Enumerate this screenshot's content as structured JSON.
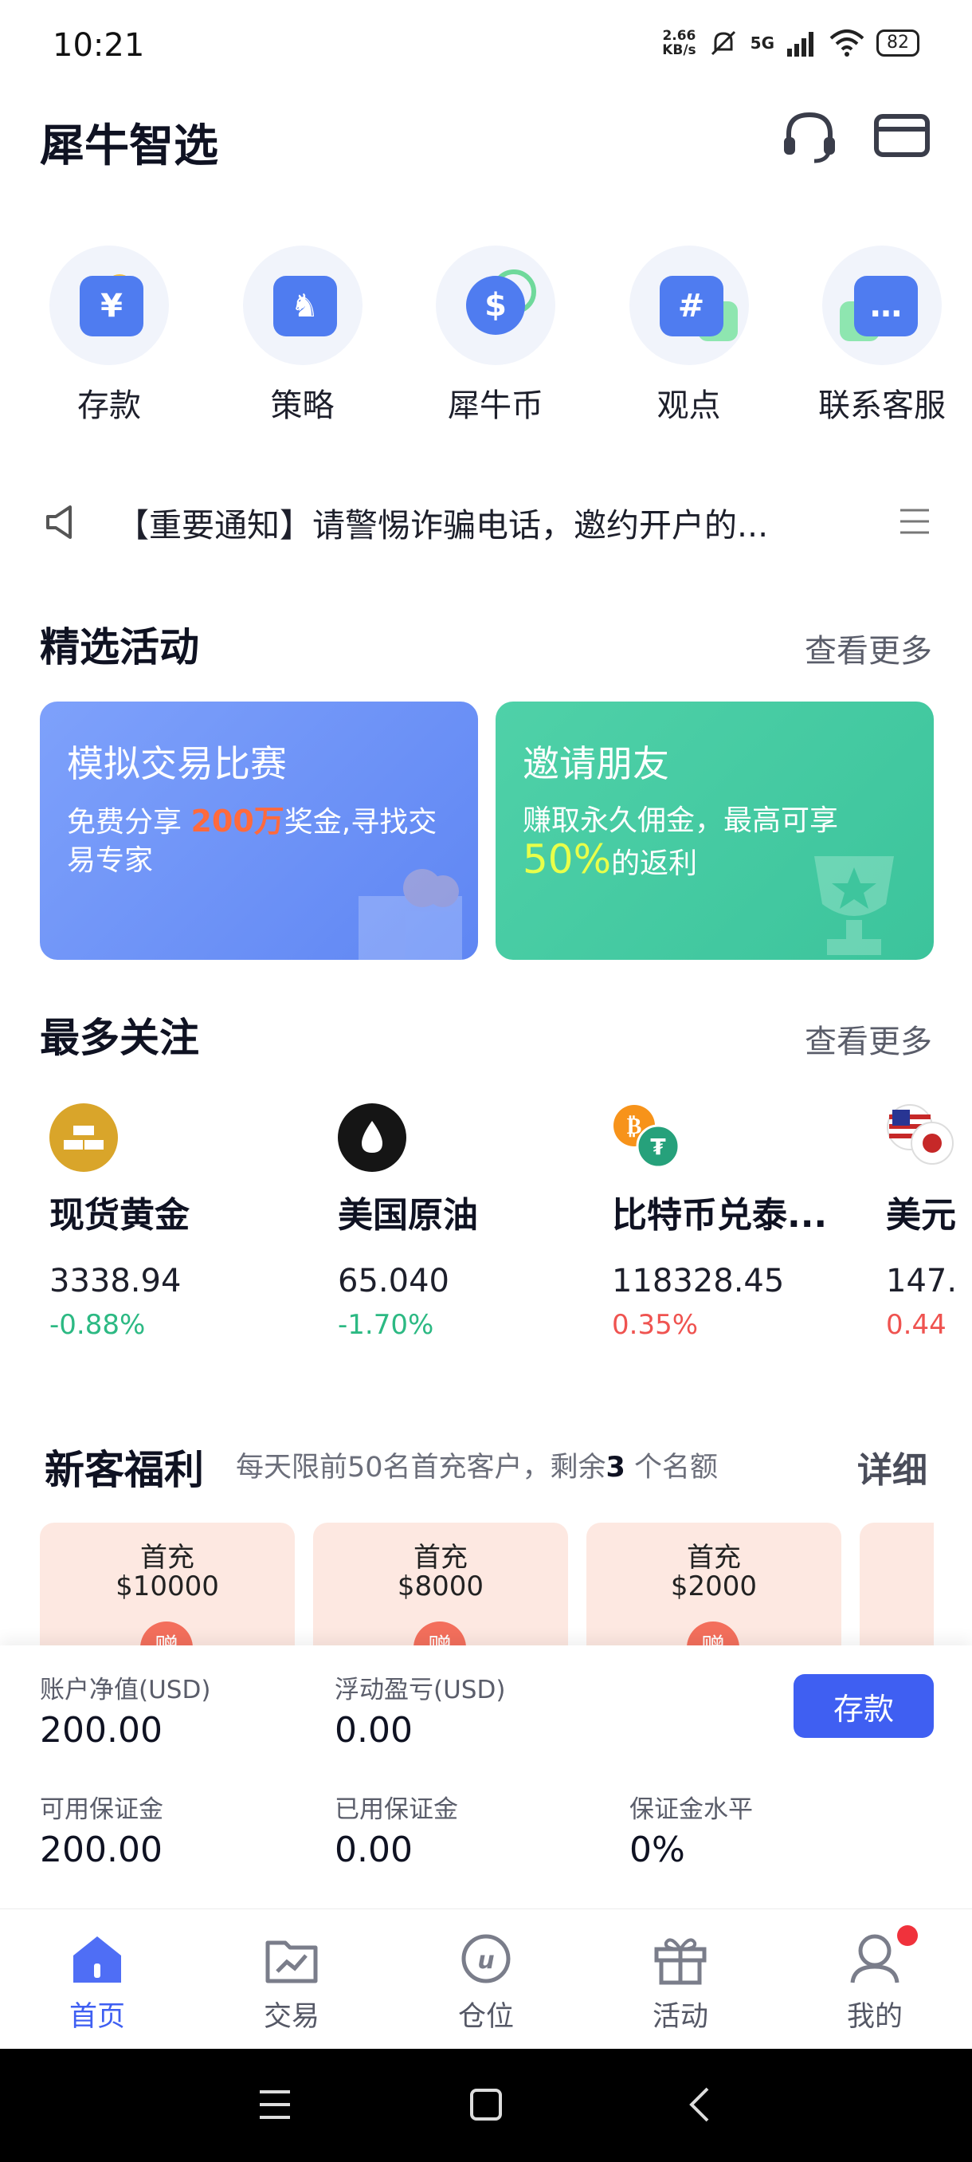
{
  "status": {
    "time": "10:21",
    "net_speed_value": "2.66",
    "net_speed_unit": "KB/s",
    "network": "5G",
    "battery": "82"
  },
  "header": {
    "title": "犀牛智选",
    "icons": [
      "headset-icon",
      "mail-icon"
    ]
  },
  "quick_menu": [
    {
      "label": "存款",
      "icon": "deposit-icon",
      "glyph": "¥"
    },
    {
      "label": "策略",
      "icon": "strategy-icon",
      "glyph": "♞"
    },
    {
      "label": "犀牛币",
      "icon": "coin-icon",
      "glyph": "$"
    },
    {
      "label": "观点",
      "icon": "hashtag-icon",
      "glyph": "#"
    },
    {
      "label": "联系客服",
      "icon": "chat-icon",
      "glyph": "…"
    }
  ],
  "notice": {
    "text": "【重要通知】请警惕诈骗电话，邀约开户的..."
  },
  "featured": {
    "title": "精选活动",
    "more": "查看更多",
    "cards": [
      {
        "title": "模拟交易比赛",
        "desc_pre": "免费分享 ",
        "highlight": "200万",
        "desc_post": "奖金,寻找交易专家"
      },
      {
        "title": "邀请朋友",
        "desc_pre": "赚取永久佣金，最高可享",
        "highlight": "50%",
        "desc_post": "的返利"
      }
    ]
  },
  "watched": {
    "title": "最多关注",
    "more": "查看更多",
    "items": [
      {
        "name": "现货黄金",
        "price": "3338.94",
        "change": "-0.88%",
        "direction": "down",
        "logo_color": "#d9a52a"
      },
      {
        "name": "美国原油",
        "price": "65.040",
        "change": "-1.70%",
        "direction": "down",
        "logo_color": "#151515"
      },
      {
        "name": "比特币兑泰...",
        "price": "118328.45",
        "change": "0.35%",
        "direction": "up",
        "logo_color": "#f7931a"
      },
      {
        "name": "美元",
        "price": "147.",
        "change": "0.44",
        "direction": "up",
        "logo_color": "#c62828"
      }
    ]
  },
  "new_customer": {
    "title": "新客福利",
    "desc_pre": "每天限前50名首充客户，剩余",
    "remaining": "3",
    "desc_post": " 个名额",
    "detail": "详细",
    "coupons": [
      {
        "line1": "首充",
        "line2": "$10000",
        "badge": "赠"
      },
      {
        "line1": "首充",
        "line2": "$8000",
        "badge": "赠"
      },
      {
        "line1": "首充",
        "line2": "$2000",
        "badge": "赠"
      },
      {
        "line1": "",
        "line2": "",
        "badge": ""
      }
    ]
  },
  "account": {
    "net_value_label": "账户净值(USD)",
    "net_value": "200.00",
    "floating_pl_label": "浮动盈亏(USD)",
    "floating_pl": "0.00",
    "deposit_button": "存款",
    "available_margin_label": "可用保证金",
    "available_margin": "200.00",
    "used_margin_label": "已用保证金",
    "used_margin": "0.00",
    "margin_level_label": "保证金水平",
    "margin_level": "0%"
  },
  "bottom_nav": [
    {
      "label": "首页",
      "icon": "home-icon",
      "active": true
    },
    {
      "label": "交易",
      "icon": "chart-icon",
      "active": false
    },
    {
      "label": "仓位",
      "icon": "position-icon",
      "active": false
    },
    {
      "label": "活动",
      "icon": "gift-icon",
      "active": false
    },
    {
      "label": "我的",
      "icon": "profile-icon",
      "active": false
    }
  ],
  "colors": {
    "primary": "#3f5ff2",
    "down": "#2cb983",
    "up": "#ef5350",
    "card_blue": "#6f95f8",
    "card_green": "#45cba2"
  }
}
